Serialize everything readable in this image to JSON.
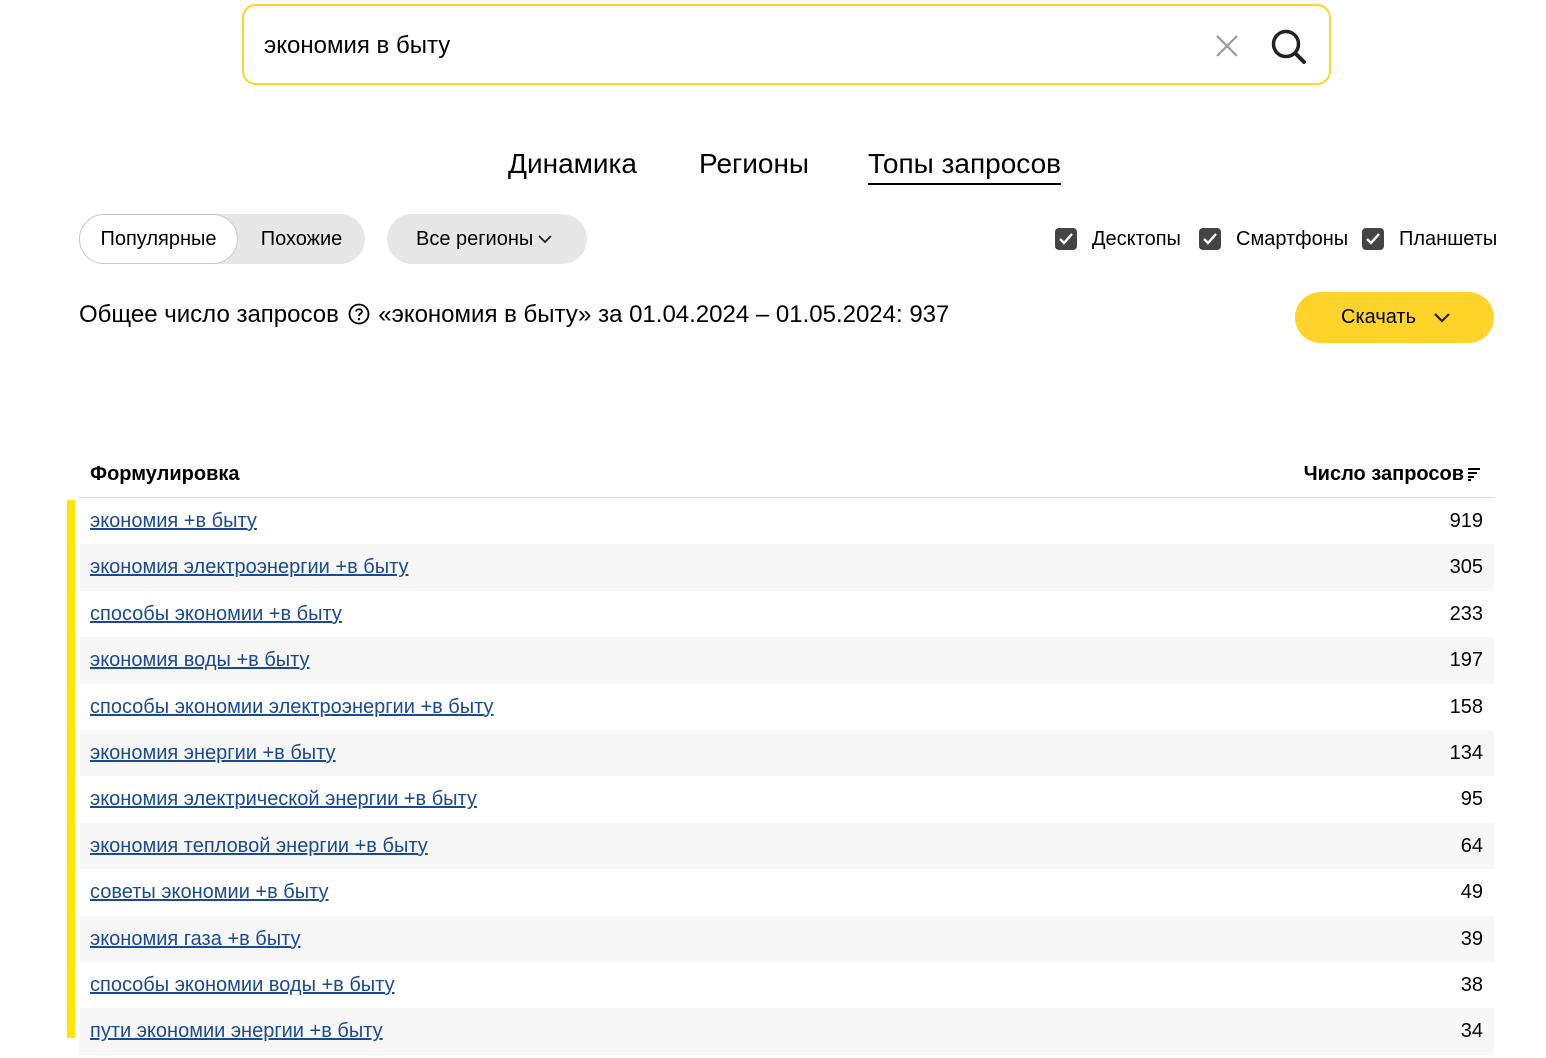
{
  "search": {
    "value": "экономия в быту",
    "clear_icon": "close-icon",
    "search_icon": "search-icon"
  },
  "tabs": [
    {
      "label": "Динамика",
      "active": false
    },
    {
      "label": "Регионы",
      "active": false
    },
    {
      "label": "Топы запросов",
      "active": true
    }
  ],
  "filters": {
    "mode_options": [
      "Популярные",
      "Похожие"
    ],
    "mode_selected": "Популярные",
    "region": "Все регионы",
    "devices": [
      {
        "label": "Десктопы",
        "checked": true
      },
      {
        "label": "Смартфоны",
        "checked": true
      },
      {
        "label": "Планшеты",
        "checked": true
      }
    ]
  },
  "summary": {
    "prefix": "Общее число запросов",
    "text": "«экономия в быту» за 01.04.2024 – 01.05.2024: 937"
  },
  "download_label": "Скачать",
  "table": {
    "col_phrase": "Формулировка",
    "col_count": "Число запросов",
    "rows": [
      {
        "phrase": "экономия +в быту",
        "count": "919"
      },
      {
        "phrase": "экономия электроэнергии +в быту",
        "count": "305"
      },
      {
        "phrase": "способы экономии +в быту",
        "count": "233"
      },
      {
        "phrase": "экономия воды +в быту",
        "count": "197"
      },
      {
        "phrase": "способы экономии электроэнергии +в быту",
        "count": "158"
      },
      {
        "phrase": "экономия энергии +в быту",
        "count": "134"
      },
      {
        "phrase": "экономия электрической энергии +в быту",
        "count": "95"
      },
      {
        "phrase": "экономия тепловой энергии +в быту",
        "count": "64"
      },
      {
        "phrase": "советы экономии +в быту",
        "count": "49"
      },
      {
        "phrase": "экономия газа +в быту",
        "count": "39"
      },
      {
        "phrase": "способы экономии воды +в быту",
        "count": "38"
      },
      {
        "phrase": "пути экономии энергии +в быту",
        "count": "34"
      }
    ]
  },
  "colors": {
    "accent_yellow": "#fed42b",
    "link_blue": "#1b4a94",
    "row_stripe": "#f7f7f7"
  }
}
